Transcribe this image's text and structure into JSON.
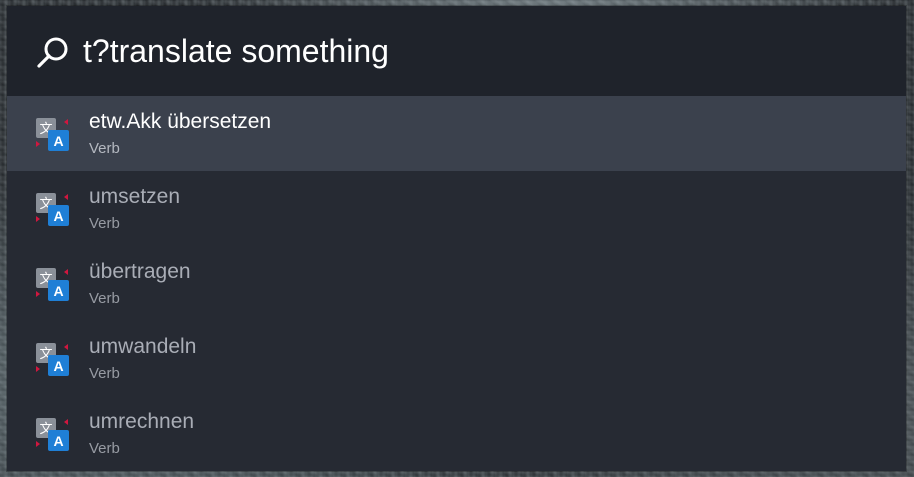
{
  "search": {
    "query": "t?translate something",
    "icon": "search-icon"
  },
  "results": [
    {
      "title": "etw.Akk übersetzen",
      "subtitle": "Verb",
      "icon": "translate-icon",
      "selected": true
    },
    {
      "title": "umsetzen",
      "subtitle": "Verb",
      "icon": "translate-icon",
      "selected": false
    },
    {
      "title": "übertragen",
      "subtitle": "Verb",
      "icon": "translate-icon",
      "selected": false
    },
    {
      "title": "umwandeln",
      "subtitle": "Verb",
      "icon": "translate-icon",
      "selected": false
    },
    {
      "title": "umrechnen",
      "subtitle": "Verb",
      "icon": "translate-icon",
      "selected": false
    }
  ],
  "colors": {
    "panel": "#262a33",
    "search_bar": "#1f232b",
    "selected_row": "#3b414d",
    "icon_blue": "#1f7fd6",
    "icon_gray": "#8a9099",
    "icon_red": "#d0173f"
  }
}
